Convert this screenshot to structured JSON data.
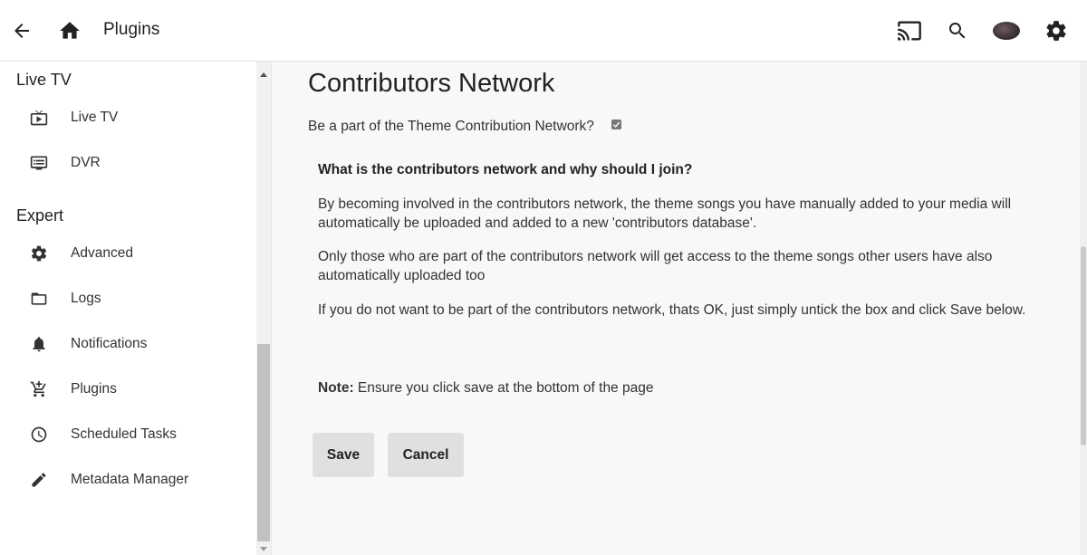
{
  "header": {
    "title": "Plugins"
  },
  "sidebar": {
    "sections": [
      {
        "title": "Live TV",
        "items": [
          {
            "label": "Live TV",
            "icon": "live-tv-icon"
          },
          {
            "label": "DVR",
            "icon": "dvr-icon"
          }
        ]
      },
      {
        "title": "Expert",
        "items": [
          {
            "label": "Advanced",
            "icon": "gear-icon"
          },
          {
            "label": "Logs",
            "icon": "folder-icon"
          },
          {
            "label": "Notifications",
            "icon": "bell-icon"
          },
          {
            "label": "Plugins",
            "icon": "cart-icon"
          },
          {
            "label": "Scheduled Tasks",
            "icon": "clock-icon"
          },
          {
            "label": "Metadata Manager",
            "icon": "pencil-icon"
          }
        ]
      }
    ]
  },
  "main": {
    "title": "Contributors Network",
    "question": "Be a part of the Theme Contribution Network?",
    "checkbox_checked": true,
    "info": {
      "heading": "What is the contributors network and why should I join?",
      "para1": "By becoming involved in the contributors network, the theme songs you have manually added to your media will automatically be uploaded and added to a new 'contributors database'.",
      "para2": "Only those who are part of the contributors network will get access to the theme songs other users have also automatically uploaded too",
      "para3": "If you do not want to be part of the contributors network, thats OK, just simply untick the box and click Save below.",
      "note_label": "Note:",
      "note_text": " Ensure you click save at the bottom of the page"
    },
    "buttons": {
      "save": "Save",
      "cancel": "Cancel"
    }
  },
  "colors": {
    "header_bg": "#ffffff",
    "sidebar_bg": "#ffffff",
    "page_bg": "#f8f8f8",
    "button_bg": "#e0e0e0"
  }
}
